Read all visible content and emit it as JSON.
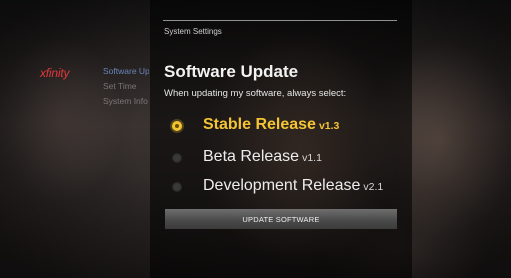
{
  "breadcrumb": "System Settings",
  "logo": "xfinity",
  "menu": {
    "items": [
      {
        "label": "Software Update"
      },
      {
        "label": "Set Time"
      },
      {
        "label": "System Info"
      }
    ]
  },
  "title": "Software Update",
  "subtitle": "When updating my software, always select:",
  "options": [
    {
      "label": "Stable Release",
      "version": "v1.3",
      "selected": true
    },
    {
      "label": "Beta Release",
      "version": "v1.1",
      "selected": false
    },
    {
      "label": "Development Release",
      "version": "v2.1",
      "selected": false
    }
  ],
  "update_button": "UPDATE SOFTWARE",
  "colors": {
    "accent": "#f4c435",
    "logo": "#e03a3a",
    "menu_active": "#6a86b8"
  }
}
